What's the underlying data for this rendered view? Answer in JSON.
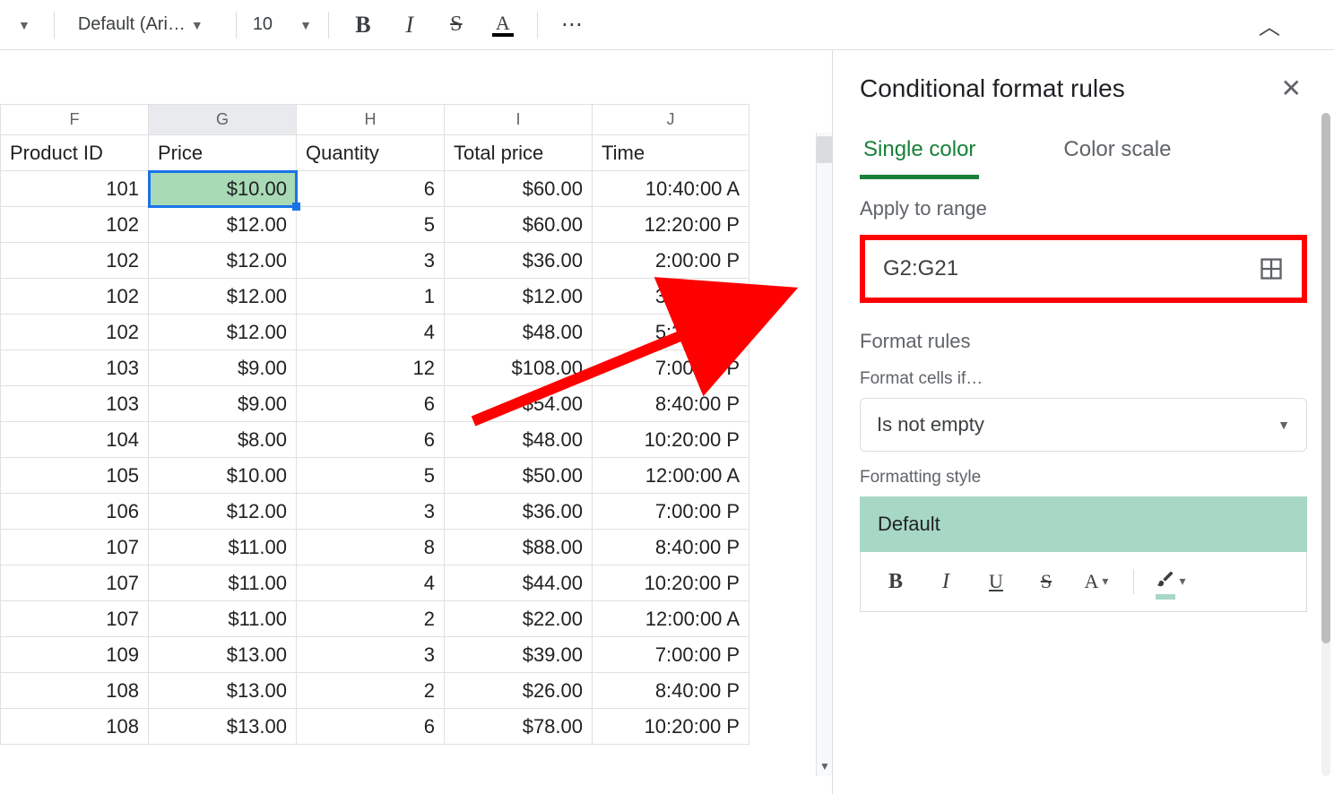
{
  "toolbar": {
    "font_name": "Default (Ari…",
    "font_size": "10",
    "bold": "B",
    "italic": "I",
    "strike": "S",
    "textcolor": "A",
    "more": "⋯"
  },
  "columns": [
    "F",
    "G",
    "H",
    "I",
    "J"
  ],
  "headers": {
    "f": "Product ID",
    "g": "Price",
    "h": "Quantity",
    "i": "Total price",
    "j": "Time"
  },
  "rows": [
    {
      "f": "101",
      "g": "$10.00",
      "h": "6",
      "i": "$60.00",
      "j": "10:40:00 A"
    },
    {
      "f": "102",
      "g": "$12.00",
      "h": "5",
      "i": "$60.00",
      "j": "12:20:00 P"
    },
    {
      "f": "102",
      "g": "$12.00",
      "h": "3",
      "i": "$36.00",
      "j": "2:00:00 P"
    },
    {
      "f": "102",
      "g": "$12.00",
      "h": "1",
      "i": "$12.00",
      "j": "3:40:00 P"
    },
    {
      "f": "102",
      "g": "$12.00",
      "h": "4",
      "i": "$48.00",
      "j": "5:20:00 P"
    },
    {
      "f": "103",
      "g": "$9.00",
      "h": "12",
      "i": "$108.00",
      "j": "7:00:00 P"
    },
    {
      "f": "103",
      "g": "$9.00",
      "h": "6",
      "i": "$54.00",
      "j": "8:40:00 P"
    },
    {
      "f": "104",
      "g": "$8.00",
      "h": "6",
      "i": "$48.00",
      "j": "10:20:00 P"
    },
    {
      "f": "105",
      "g": "$10.00",
      "h": "5",
      "i": "$50.00",
      "j": "12:00:00 A"
    },
    {
      "f": "106",
      "g": "$12.00",
      "h": "3",
      "i": "$36.00",
      "j": "7:00:00 P"
    },
    {
      "f": "107",
      "g": "$11.00",
      "h": "8",
      "i": "$88.00",
      "j": "8:40:00 P"
    },
    {
      "f": "107",
      "g": "$11.00",
      "h": "4",
      "i": "$44.00",
      "j": "10:20:00 P"
    },
    {
      "f": "107",
      "g": "$11.00",
      "h": "2",
      "i": "$22.00",
      "j": "12:00:00 A"
    },
    {
      "f": "109",
      "g": "$13.00",
      "h": "3",
      "i": "$39.00",
      "j": "7:00:00 P"
    },
    {
      "f": "108",
      "g": "$13.00",
      "h": "2",
      "i": "$26.00",
      "j": "8:40:00 P"
    },
    {
      "f": "108",
      "g": "$13.00",
      "h": "6",
      "i": "$78.00",
      "j": "10:20:00 P"
    }
  ],
  "sidebar": {
    "title": "Conditional format rules",
    "tabs": {
      "single": "Single color",
      "scale": "Color scale"
    },
    "apply_label": "Apply to range",
    "range_value": "G2:G21",
    "rules_label": "Format rules",
    "cells_if_label": "Format cells if…",
    "condition": "Is not empty",
    "style_label": "Formatting style",
    "style_preview": "Default",
    "st": {
      "bold": "B",
      "italic": "I",
      "under": "U",
      "strike": "S",
      "color": "A"
    }
  }
}
